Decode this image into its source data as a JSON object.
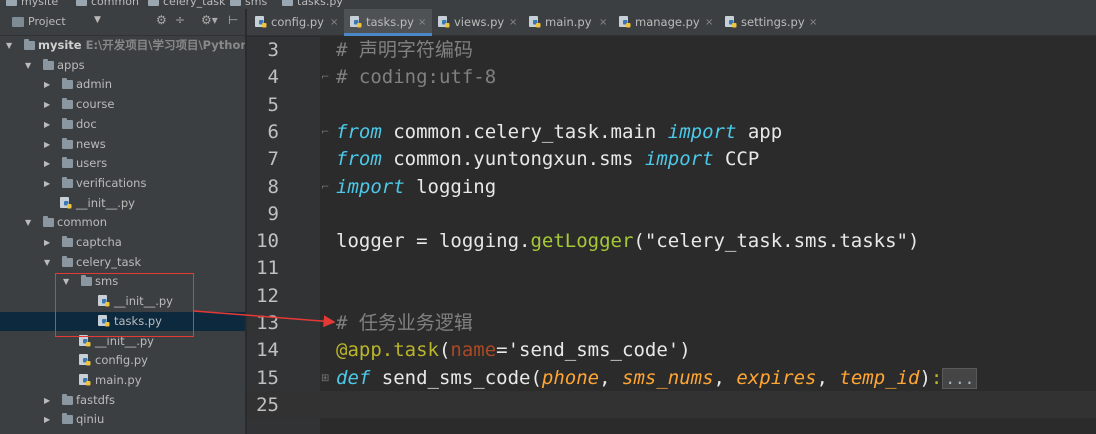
{
  "breadcrumbs": [
    "mysite",
    "common",
    "celery_task",
    "sms",
    "tasks.py"
  ],
  "project": {
    "title": "Project",
    "dropdown": "▼",
    "tools": [
      "⚙",
      "÷",
      "⚙▾",
      "⊢"
    ],
    "tree": [
      {
        "label": "mysite",
        "path": "E:\\开发项目\\学习项目\\Python\\m",
        "indent": 0,
        "kind": "folder",
        "arrow": "▼",
        "bold": true
      },
      {
        "label": "apps",
        "indent": 1,
        "kind": "folder",
        "arrow": "▼"
      },
      {
        "label": "admin",
        "indent": 2,
        "kind": "folder",
        "arrow": "▶"
      },
      {
        "label": "course",
        "indent": 2,
        "kind": "folder",
        "arrow": "▶"
      },
      {
        "label": "doc",
        "indent": 2,
        "kind": "folder",
        "arrow": "▶"
      },
      {
        "label": "news",
        "indent": 2,
        "kind": "folder",
        "arrow": "▶"
      },
      {
        "label": "users",
        "indent": 2,
        "kind": "folder",
        "arrow": "▶"
      },
      {
        "label": "verifications",
        "indent": 2,
        "kind": "folder",
        "arrow": "▶"
      },
      {
        "label": "__init__.py",
        "indent": 2,
        "kind": "py",
        "arrow": ""
      },
      {
        "label": "common",
        "indent": 1,
        "kind": "folder",
        "arrow": "▼"
      },
      {
        "label": "captcha",
        "indent": 2,
        "kind": "folder",
        "arrow": "▶"
      },
      {
        "label": "celery_task",
        "indent": 2,
        "kind": "folder",
        "arrow": "▼"
      },
      {
        "label": "sms",
        "indent": 3,
        "kind": "folder",
        "arrow": "▼"
      },
      {
        "label": "__init__.py",
        "indent": 4,
        "kind": "py",
        "arrow": ""
      },
      {
        "label": "tasks.py",
        "indent": 4,
        "kind": "py",
        "arrow": "",
        "selected": true
      },
      {
        "label": "__init__.py",
        "indent": 3,
        "kind": "py",
        "arrow": ""
      },
      {
        "label": "config.py",
        "indent": 3,
        "kind": "py",
        "arrow": ""
      },
      {
        "label": "main.py",
        "indent": 3,
        "kind": "py",
        "arrow": ""
      },
      {
        "label": "fastdfs",
        "indent": 2,
        "kind": "folder",
        "arrow": "▶"
      },
      {
        "label": "qiniu",
        "indent": 2,
        "kind": "folder",
        "arrow": "▶"
      }
    ]
  },
  "tabs": [
    {
      "label": "config.py",
      "active": false
    },
    {
      "label": "tasks.py",
      "active": true
    },
    {
      "label": "views.py",
      "active": false
    },
    {
      "label": "main.py",
      "active": false
    },
    {
      "label": "manage.py",
      "active": false
    },
    {
      "label": "settings.py",
      "active": false
    }
  ],
  "tab_close_glyph": "×",
  "editor": {
    "lines": [
      {
        "n": "3",
        "tokens": [
          [
            "cm",
            "# 声明字符编码"
          ]
        ]
      },
      {
        "n": "4",
        "tokens": [
          [
            "cm",
            "# coding:utf-8"
          ]
        ],
        "fold": "⌐"
      },
      {
        "n": "5",
        "tokens": []
      },
      {
        "n": "6",
        "tokens": [
          [
            "kw",
            "from"
          ],
          [
            "plain",
            " common.celery_task.main "
          ],
          [
            "kw",
            "import"
          ],
          [
            "plain",
            " app"
          ]
        ],
        "fold": "⌐"
      },
      {
        "n": "7",
        "tokens": [
          [
            "kw",
            "from"
          ],
          [
            "plain",
            " common.yuntongxun.sms "
          ],
          [
            "kw",
            "import"
          ],
          [
            "plain",
            " CCP"
          ]
        ]
      },
      {
        "n": "8",
        "tokens": [
          [
            "kw",
            "import"
          ],
          [
            "plain",
            " logging"
          ]
        ],
        "fold": "⌐"
      },
      {
        "n": "9",
        "tokens": []
      },
      {
        "n": "10",
        "tokens": [
          [
            "plain",
            "logger = logging."
          ],
          [
            "fn",
            "getLogger"
          ],
          [
            "plain",
            "(\"celery_task.sms.tasks\")"
          ]
        ]
      },
      {
        "n": "11",
        "tokens": []
      },
      {
        "n": "12",
        "tokens": []
      },
      {
        "n": "13",
        "tokens": [
          [
            "cm",
            "# 任务业务逻辑"
          ]
        ]
      },
      {
        "n": "14",
        "tokens": [
          [
            "dec",
            "@app.task"
          ],
          [
            "plain",
            "("
          ],
          [
            "par",
            "name"
          ],
          [
            "plain",
            "='send_sms_code')"
          ]
        ]
      },
      {
        "n": "15",
        "tokens": [
          [
            "kw",
            "def"
          ],
          [
            "plain",
            " send_sms_code("
          ],
          [
            "prm",
            "phone"
          ],
          [
            "plain",
            ", "
          ],
          [
            "prm",
            "sms_nums"
          ],
          [
            "plain",
            ", "
          ],
          [
            "prm",
            "expires"
          ],
          [
            "plain",
            ", "
          ],
          [
            "prm",
            "temp_id"
          ],
          [
            "plain",
            ")"
          ],
          [
            "dec",
            ":"
          ],
          [
            "fold",
            "..."
          ]
        ],
        "fold": "⊞"
      },
      {
        "n": "25",
        "tokens": [],
        "caret": true
      }
    ]
  },
  "colors": {
    "annotation": "#e53935",
    "selection": "#0d293e",
    "tab_accent": "#4a88c7"
  }
}
